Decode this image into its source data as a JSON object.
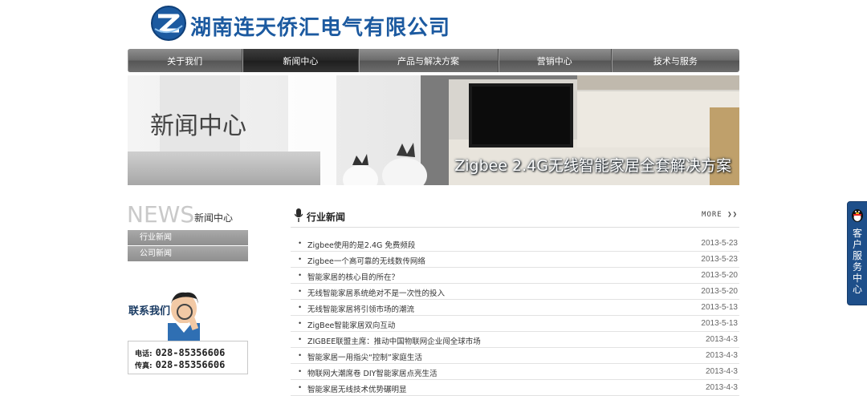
{
  "header": {
    "company_name": "湖南连天侨汇电气有限公司"
  },
  "nav": {
    "items": [
      {
        "label": "关于我们",
        "width": 143
      },
      {
        "label": "新闻中心",
        "width": 145,
        "active": true
      },
      {
        "label": "产品与解决方案",
        "width": 173
      },
      {
        "label": "营销中心",
        "width": 141
      },
      {
        "label": "技术与服务",
        "width": 160
      }
    ]
  },
  "banner": {
    "title": "新闻中心",
    "caption": "Zigbee 2.4G无线智能家居全套解决方案"
  },
  "sidebar": {
    "heading_en": "NEWS",
    "heading_cn": "新闻中心",
    "menu": [
      "行业新闻",
      "公司新闻"
    ],
    "contact": {
      "label": "联系我们",
      "phone_label": "电话:",
      "phone": "028-85356606",
      "fax_label": "传真:",
      "fax": "028-85356606"
    }
  },
  "news": {
    "title": "行业新闻",
    "more": "MORE",
    "items": [
      {
        "title": "Zigbee使用的是2.4G 免费频段",
        "date": "2013-5-23"
      },
      {
        "title": "Zigbee一个高可靠的无线数传网络",
        "date": "2013-5-23"
      },
      {
        "title": "智能家居的核心目的所在？",
        "date": "2013-5-20"
      },
      {
        "title": "无线智能家居系统绝对不是一次性的投入",
        "date": "2013-5-20"
      },
      {
        "title": "无线智能家居将引领市场的潮流",
        "date": "2013-5-13"
      },
      {
        "title": "ZigBee智能家居双向互动",
        "date": "2013-5-13"
      },
      {
        "title": "ZIGBEE联盟主席：推动中国物联网企业闯全球市场",
        "date": "2013-4-3"
      },
      {
        "title": "智能家居一用指尖“控制”家庭生活",
        "date": "2013-4-3"
      },
      {
        "title": "物联网大潮席卷 DIY智能家居点亮生活",
        "date": "2013-4-3"
      },
      {
        "title": "智能家居无线技术优势碾明显",
        "date": "2013-4-3"
      }
    ]
  },
  "service": {
    "label": "客户服务中心"
  }
}
